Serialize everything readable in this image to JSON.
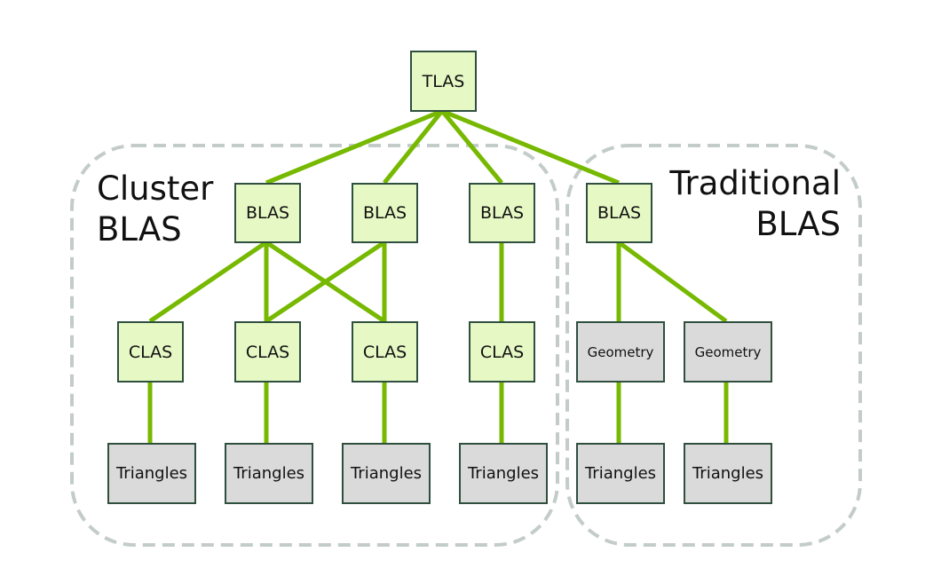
{
  "groups": {
    "cluster": {
      "label_line1": "Cluster",
      "label_line2": "BLAS"
    },
    "traditional": {
      "label_line1": "Traditional",
      "label_line2": "BLAS"
    }
  },
  "nodes": {
    "tlas": "TLAS",
    "blas": [
      "BLAS",
      "BLAS",
      "BLAS",
      "BLAS"
    ],
    "clas": [
      "CLAS",
      "CLAS",
      "CLAS",
      "CLAS"
    ],
    "geometry": [
      "Geometry",
      "Geometry"
    ],
    "triangles": [
      "Triangles",
      "Triangles",
      "Triangles",
      "Triangles",
      "Triangles",
      "Triangles"
    ]
  },
  "colors": {
    "edge": "#76b900",
    "group_border": "#c3ccc8",
    "node_fill_green": "#e6f8c4",
    "node_fill_gray": "#dadada"
  }
}
